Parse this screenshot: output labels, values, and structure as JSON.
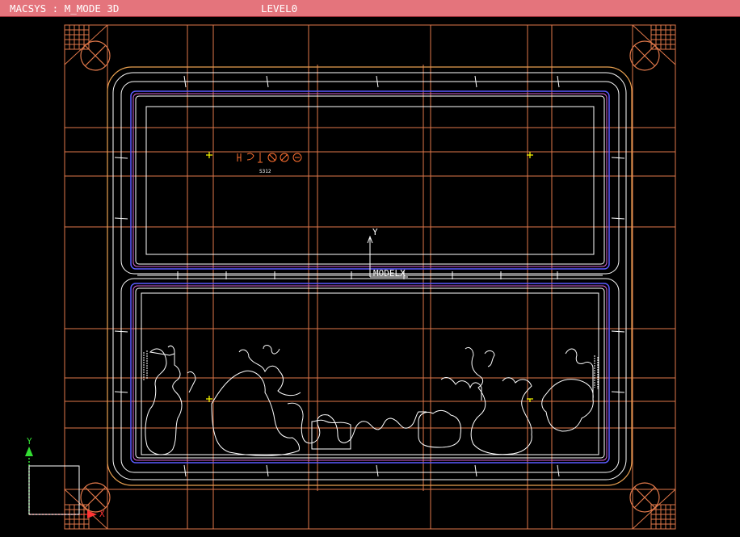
{
  "window": {
    "title": "MACSYS : M_MODE 3D",
    "level": "LEVEL0"
  },
  "canvas": {
    "background": "#000000",
    "colors": {
      "titlebar": "#e4747c",
      "grid": "#e0784a",
      "outline": "#ffffff",
      "cavity_blue": "#5b5bff",
      "cavity_magenta": "#d060d0",
      "marker": "#ffff00",
      "axis_y": "#33dd33",
      "axis_x": "#ff3333"
    },
    "labels": {
      "model_y": "Y",
      "model_x": "MODELX",
      "gizmo_y": "Y",
      "gizmo_x": "X"
    },
    "emboss_text": "S312"
  }
}
